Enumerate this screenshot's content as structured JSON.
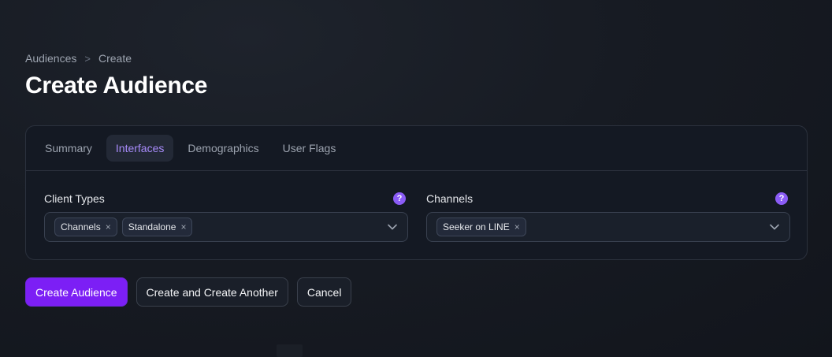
{
  "breadcrumb": {
    "items": [
      "Audiences",
      "Create"
    ],
    "separator": ">"
  },
  "page": {
    "title": "Create Audience"
  },
  "tabs": [
    {
      "label": "Summary",
      "active": false
    },
    {
      "label": "Interfaces",
      "active": true
    },
    {
      "label": "Demographics",
      "active": false
    },
    {
      "label": "User Flags",
      "active": false
    }
  ],
  "fields": {
    "client_types": {
      "label": "Client Types",
      "help": "?",
      "selected": [
        "Channels",
        "Standalone"
      ]
    },
    "channels": {
      "label": "Channels",
      "help": "?",
      "selected": [
        "Seeker on LINE"
      ]
    }
  },
  "chip_remove_glyph": "×",
  "actions": {
    "create_label": "Create Audience",
    "create_another_label": "Create and Create Another",
    "cancel_label": "Cancel"
  },
  "colors": {
    "accent": "#7c1ff5",
    "active_tab_text": "#a78bfa",
    "help_icon": "#8b5cf6"
  }
}
